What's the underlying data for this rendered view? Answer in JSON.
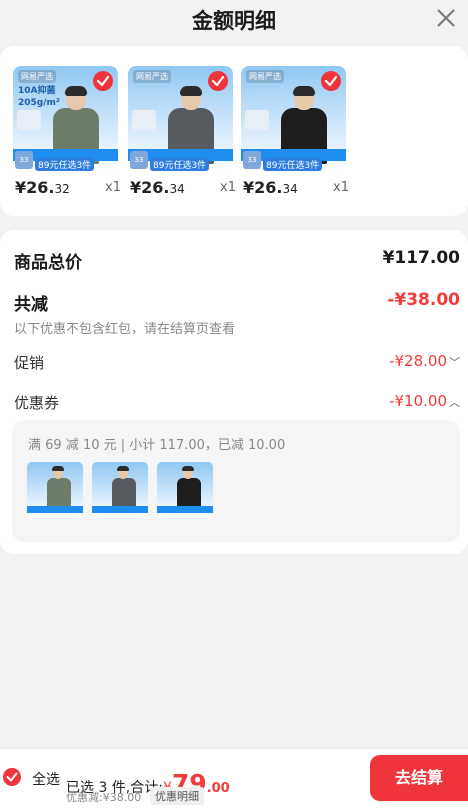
{
  "header": {
    "title": "金额明细"
  },
  "products": [
    {
      "brand": "网易严选",
      "spec_line1": "10A抑菌",
      "spec_line2": "205g/m²",
      "promo": "89元任选3件",
      "price_main": "¥26.",
      "price_cents": "32",
      "qty": "x1",
      "shirt_color": "#6e7d6a"
    },
    {
      "brand": "网易严选",
      "spec_line1": "",
      "spec_line2": "",
      "promo": "89元任选3件",
      "price_main": "¥26.",
      "price_cents": "34",
      "qty": "x1",
      "shirt_color": "#575b60"
    },
    {
      "brand": "网易严选",
      "spec_line1": "",
      "spec_line2": "",
      "promo": "89元任选3件",
      "price_main": "¥26.",
      "price_cents": "34",
      "qty": "x1",
      "shirt_color": "#1e1e1e"
    }
  ],
  "summary": {
    "total_label": "商品总价",
    "total_value": "¥117.00",
    "reduce_label": "共减",
    "reduce_value": "-¥38.00",
    "note": "以下优惠不包含红包，请在结算页查看",
    "promo_label": "促销",
    "promo_value": "-¥28.00",
    "coupon_label": "优惠券",
    "coupon_value": "-¥10.00",
    "coupon_detail": "满 69 减 10 元 | 小计 117.00，已减 10.00"
  },
  "bottom": {
    "select_all": "全选",
    "selected_text": "已选 3 件,合计:",
    "total_yen": "¥",
    "total_big": "79",
    "total_cents": ".00",
    "discount_text": "优惠减:¥38.00",
    "detail_chip": "优惠明细",
    "checkout": "去结算"
  },
  "colors": {
    "accent": "#f0343c",
    "red_text": "#f23b3b"
  },
  "icons": {
    "close": "close-icon",
    "check": "checkmark-icon"
  }
}
